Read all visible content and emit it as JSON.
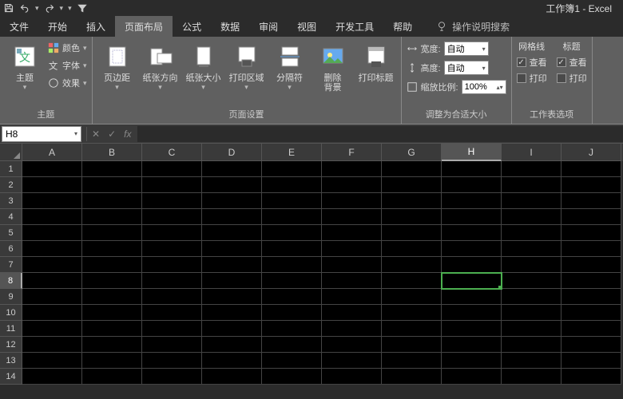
{
  "title": "工作簿1 - Excel",
  "tabs": [
    "文件",
    "开始",
    "插入",
    "页面布局",
    "公式",
    "数据",
    "审阅",
    "视图",
    "开发工具",
    "帮助"
  ],
  "activeTab": 3,
  "tellMe": "操作说明搜索",
  "ribbon": {
    "theme": {
      "label": "主题",
      "themes": "主题",
      "colors": "颜色",
      "fonts": "字体",
      "effects": "效果"
    },
    "pageSetup": {
      "label": "页面设置",
      "margins": "页边距",
      "orientation": "纸张方向",
      "size": "纸张大小",
      "printArea": "打印区域",
      "breaks": "分隔符",
      "background": "删除\n背景",
      "titles": "打印标题"
    },
    "scale": {
      "label": "调整为合适大小",
      "width": "宽度:",
      "height": "高度:",
      "scale": "缩放比例:",
      "auto": "自动",
      "pct": "100%"
    },
    "sheetOptions": {
      "label": "工作表选项",
      "gridlines": "网格线",
      "headings": "标题",
      "view": "查看",
      "print": "打印"
    }
  },
  "nameBox": "H8",
  "columns": [
    "A",
    "B",
    "C",
    "D",
    "E",
    "F",
    "G",
    "H",
    "I",
    "J"
  ],
  "selectedCol": 7,
  "rows": [
    1,
    2,
    3,
    4,
    5,
    6,
    7,
    8,
    9,
    10,
    11,
    12,
    13,
    14
  ],
  "selectedRow": 7
}
